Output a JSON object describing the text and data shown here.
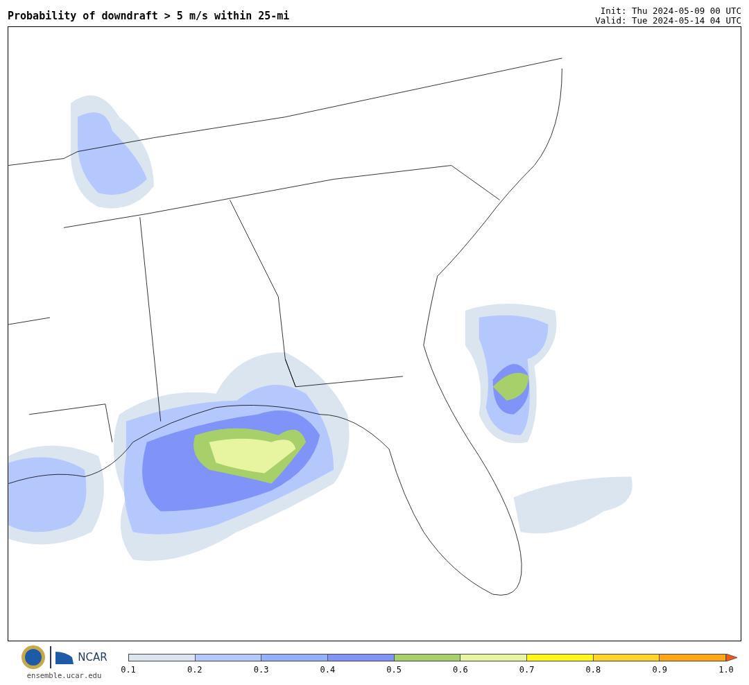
{
  "title": "Probability of downdraft > 5 m/s within 25-mi",
  "init": "Init: Thu 2024-05-09 00 UTC",
  "valid": "Valid: Tue 2024-05-14 04 UTC",
  "footer": {
    "site": "ensemble.ucar.edu",
    "logo_text": "NCAR"
  },
  "colorbar": {
    "segments": [
      {
        "color": "#dbe5f0"
      },
      {
        "color": "#b5c8fd"
      },
      {
        "color": "#92b0fb"
      },
      {
        "color": "#7f93f8"
      },
      {
        "color": "#a8d06a"
      },
      {
        "color": "#e8f5a0"
      },
      {
        "color": "#fff71a"
      },
      {
        "color": "#ffd328"
      },
      {
        "color": "#fea616"
      },
      {
        "color": "#f05a14",
        "kind": "arrow"
      }
    ],
    "ticks": [
      "0.1",
      "0.2",
      "0.3",
      "0.4",
      "0.5",
      "0.6",
      "0.7",
      "0.8",
      "0.9",
      "1.0"
    ]
  }
}
